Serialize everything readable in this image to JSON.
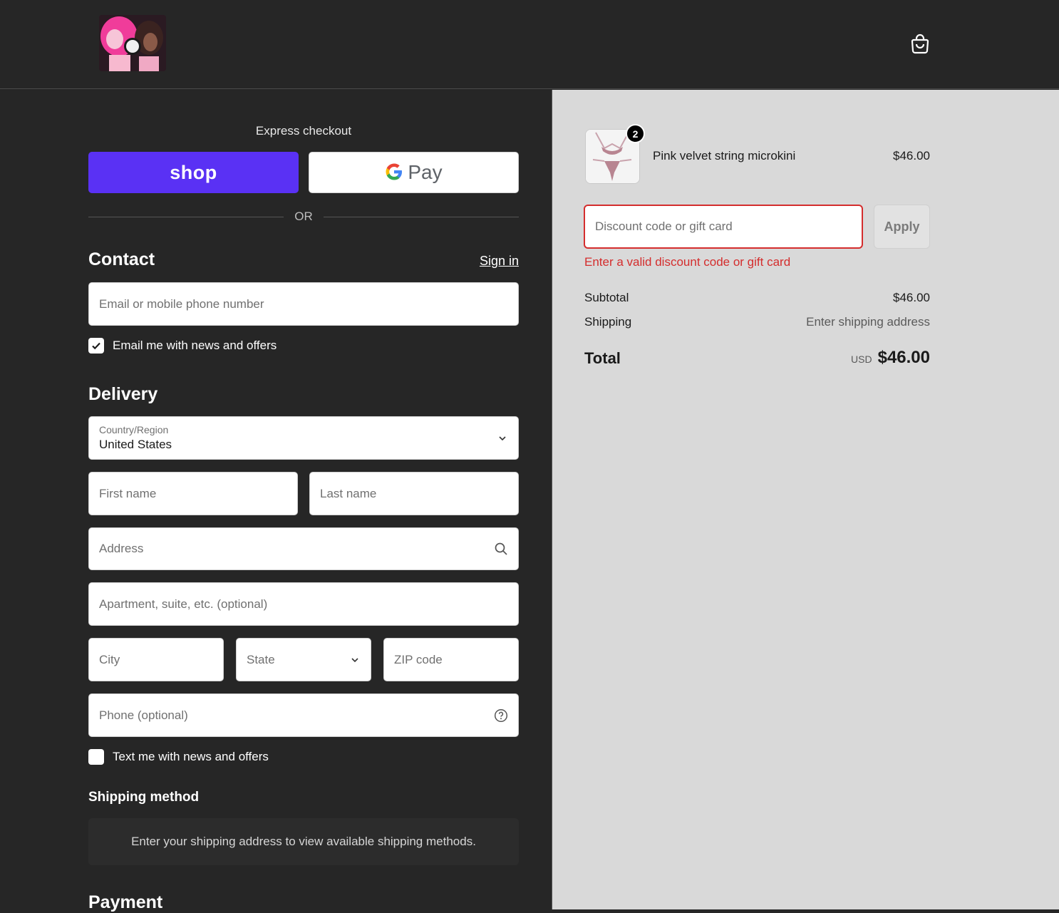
{
  "header": {
    "cart_icon": "shopping-bag-icon"
  },
  "express": {
    "title": "Express checkout",
    "shop_label": "shop",
    "gpay_label": "Pay",
    "or": "OR"
  },
  "contact": {
    "title": "Contact",
    "sign_in": "Sign in",
    "email_placeholder": "Email or mobile phone number",
    "email_news": "Email me with news and offers",
    "email_news_checked": true
  },
  "delivery": {
    "title": "Delivery",
    "country_label": "Country/Region",
    "country_value": "United States",
    "first_name": "First name",
    "last_name": "Last name",
    "address": "Address",
    "apartment": "Apartment, suite, etc. (optional)",
    "city": "City",
    "state": "State",
    "zip": "ZIP code",
    "phone": "Phone (optional)",
    "text_news": "Text me with news and offers",
    "text_news_checked": false
  },
  "shipping_method": {
    "title": "Shipping method",
    "message": "Enter your shipping address to view available shipping methods."
  },
  "payment": {
    "title": "Payment"
  },
  "summary": {
    "item": {
      "name": "Pink velvet string microkini",
      "price": "$46.00",
      "quantity": "2"
    },
    "discount_placeholder": "Discount code or gift card",
    "apply_label": "Apply",
    "error": "Enter a valid discount code or gift card",
    "subtotal_label": "Subtotal",
    "subtotal_value": "$46.00",
    "shipping_label": "Shipping",
    "shipping_value": "Enter shipping address",
    "total_label": "Total",
    "total_currency": "USD",
    "total_value": "$46.00"
  },
  "colors": {
    "shop_purple": "#5a31f4",
    "error_red": "#d42d2d",
    "dark_bg": "#262626",
    "summary_bg": "#d9d9d9"
  }
}
